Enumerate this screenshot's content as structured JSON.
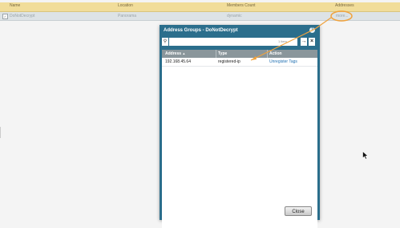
{
  "background_table": {
    "headers": [
      "Name",
      "Location",
      "Members Count",
      "Addresses"
    ],
    "row": {
      "checked": "✓",
      "name": "DoNotDecrypt",
      "location": "Panorama",
      "members_count": "dynamic",
      "addresses": "more..."
    }
  },
  "dialog": {
    "title": "Address Groups - DoNotDecrypt",
    "help_glyph": "?",
    "filter": {
      "placeholder": "",
      "item_count": "1 item"
    },
    "columns": [
      "Address",
      "Type",
      "Action"
    ],
    "sort_indicator": "▲",
    "rows": [
      {
        "address": "192.168.45.64",
        "type": "registered-ip",
        "action": "Unregister Tags"
      }
    ],
    "close_label": "Close"
  },
  "colors": {
    "annotation": "#f0a23c",
    "dialog": "#2b6e8c",
    "header": "#f1dd9a",
    "link": "#1f6fb2"
  }
}
